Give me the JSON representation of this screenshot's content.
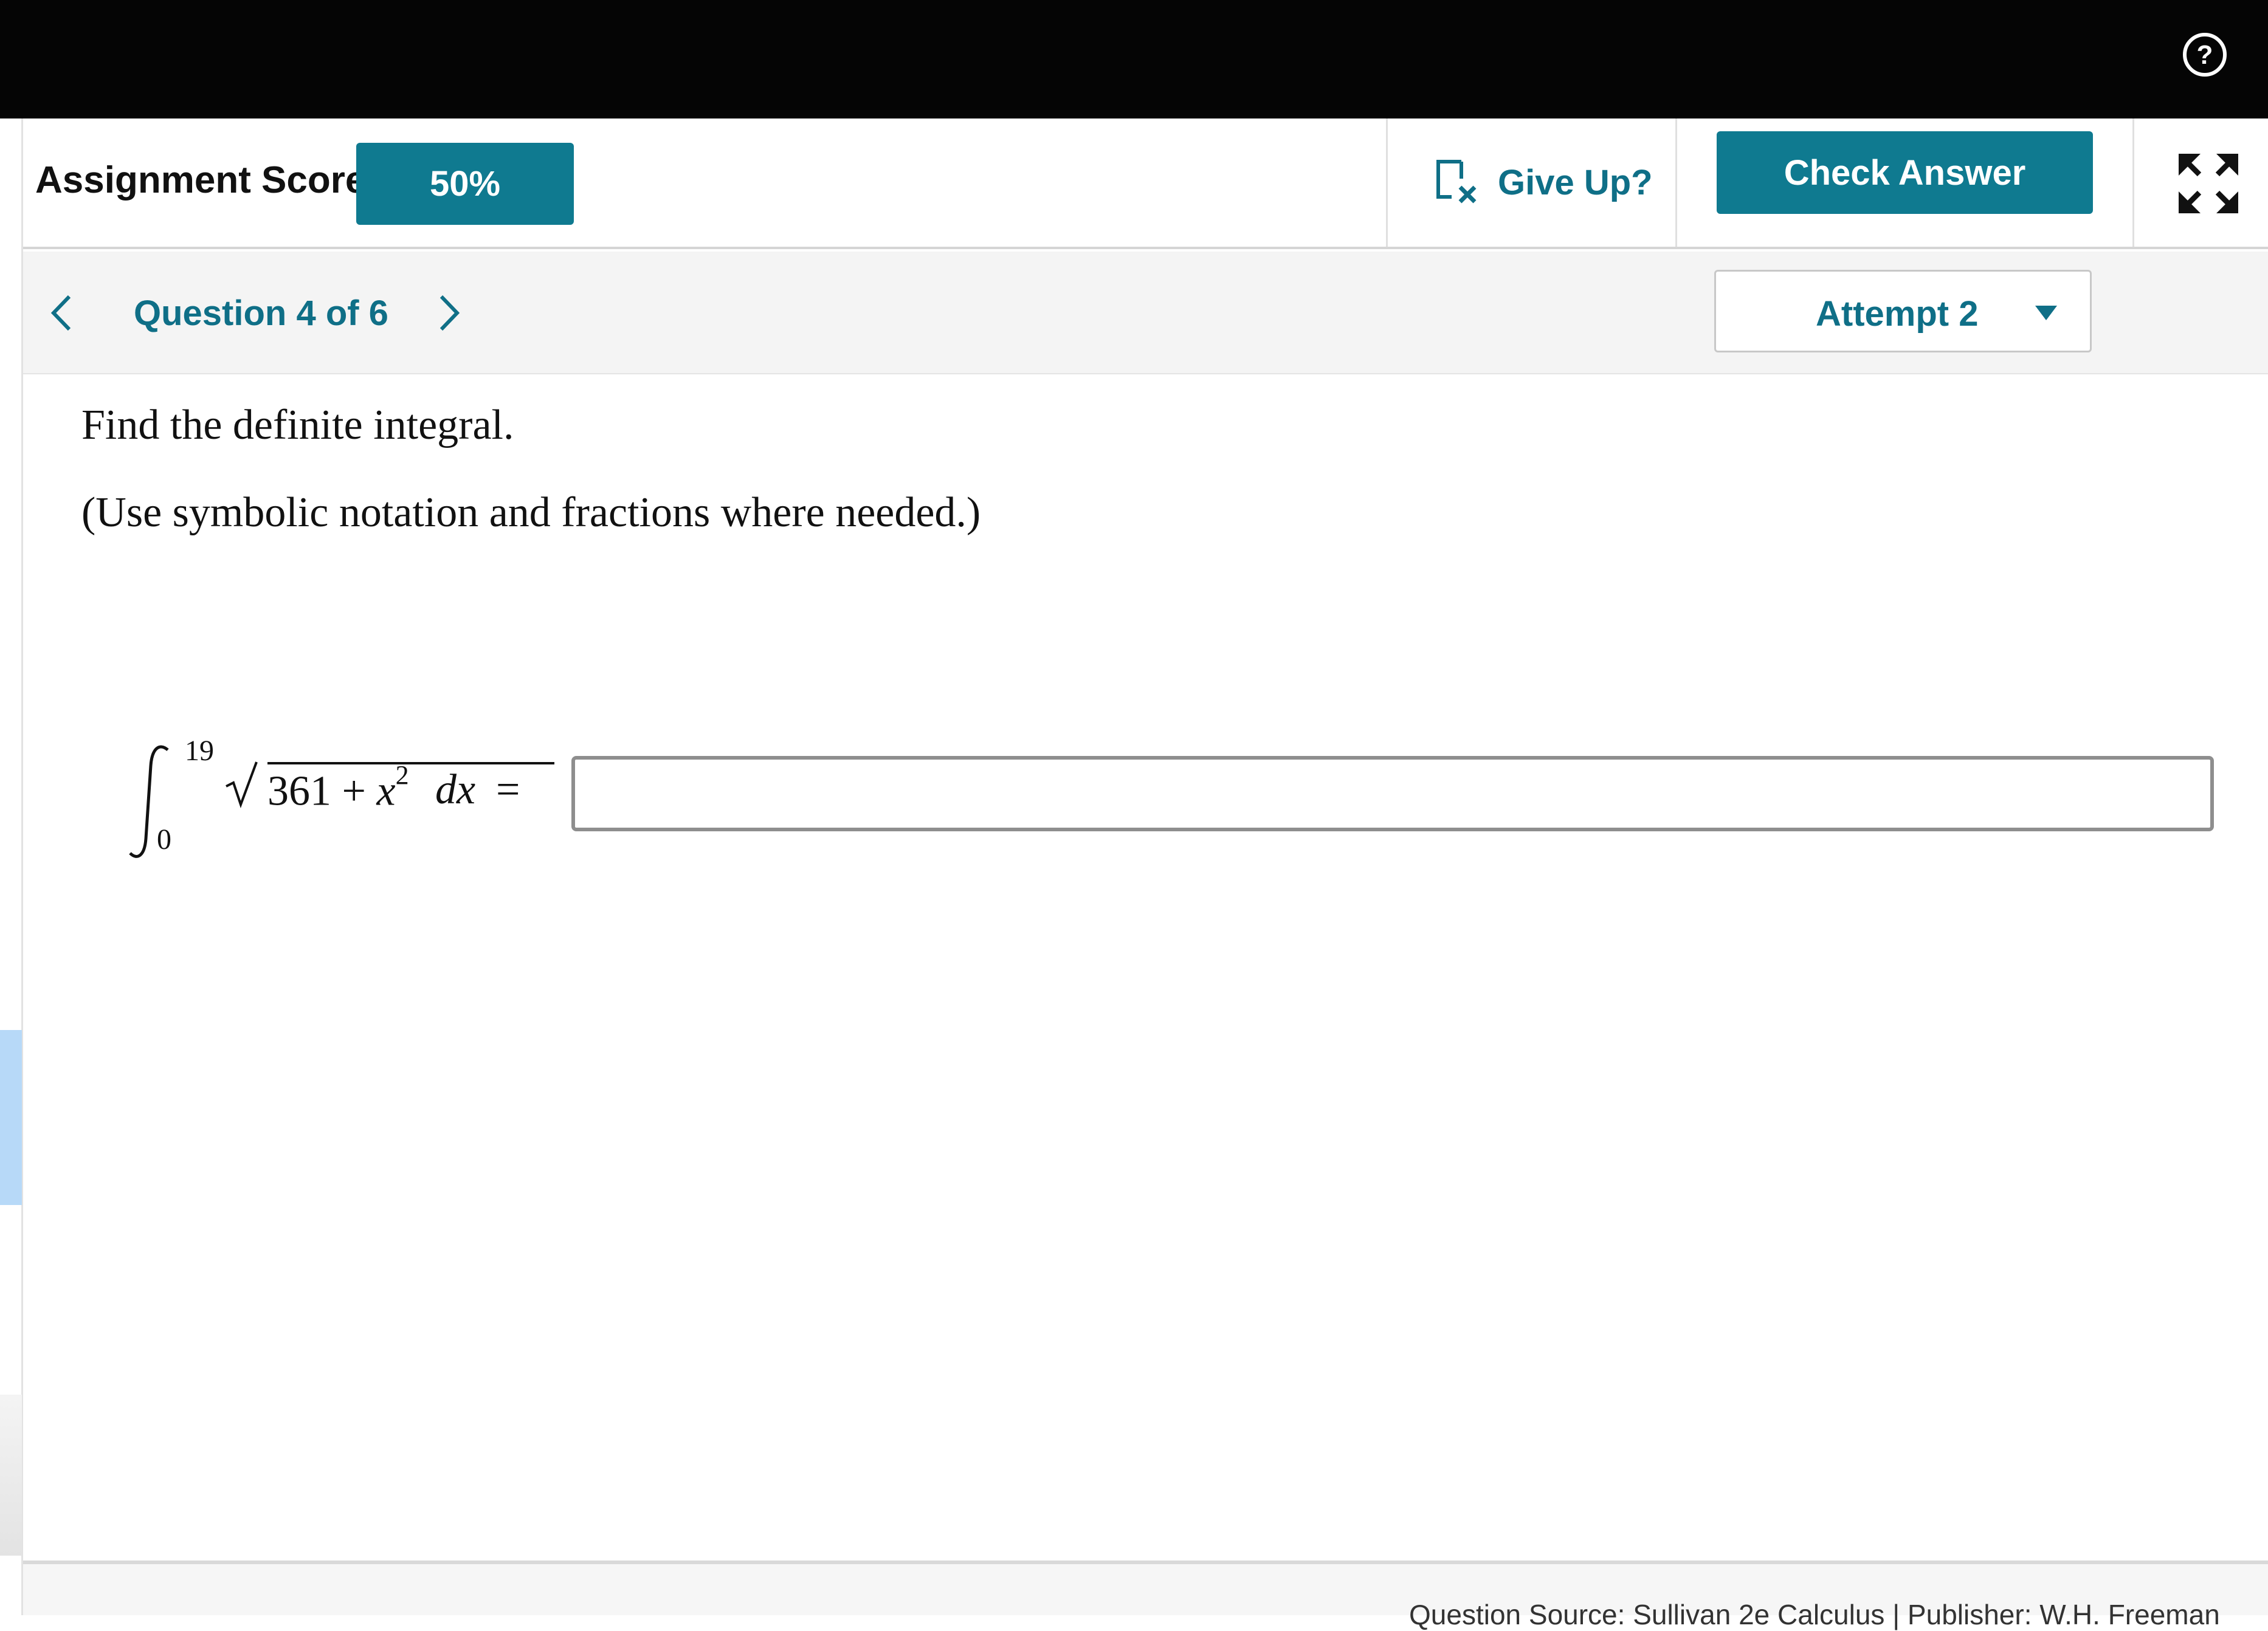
{
  "header": {
    "help_icon": "help-circle-icon"
  },
  "score": {
    "label": "Assignment Score:",
    "value": "50%"
  },
  "actions": {
    "give_up": "Give Up?",
    "give_up_icon": "give-up-icon",
    "check_answer": "Check Answer",
    "expand_icon": "expand-icon"
  },
  "navigation": {
    "question_label": "Question 4 of 6",
    "attempt_label": "Attempt 2"
  },
  "question": {
    "prompt": "Find the definite integral.",
    "hint": "(Use symbolic notation and fractions where needed.)",
    "lower_limit": "0",
    "upper_limit": "19",
    "radicand_constant": "361 + ",
    "radicand_variable": "x",
    "radicand_exponent": "2",
    "differential": "dx",
    "equals": "=",
    "answer_value": ""
  },
  "footer": {
    "source_text": "Question Source: Sullivan 2e Calculus   |   Publisher: W.H. Freeman"
  },
  "colors": {
    "accent": "#0f7a90",
    "link": "#0f6f87",
    "topbar": "#050505"
  }
}
